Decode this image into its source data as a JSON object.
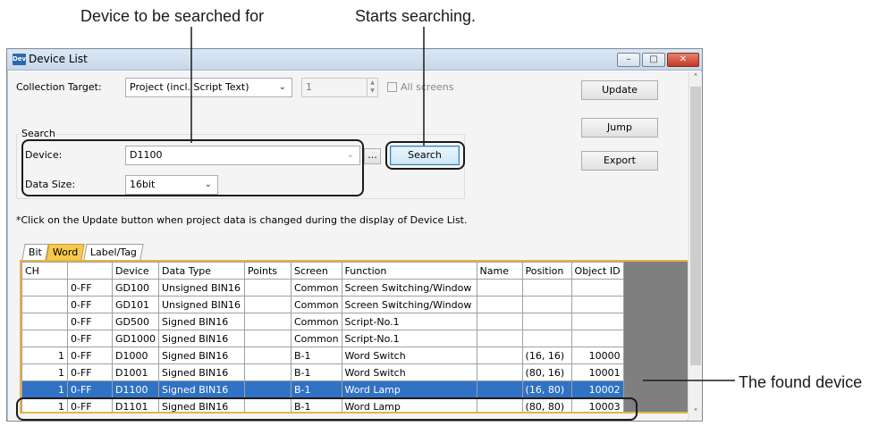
{
  "callouts": {
    "device_label": "Device to be searched for",
    "search_label": "Starts searching.",
    "found_label": "The found device"
  },
  "window": {
    "icon_text": "Dev",
    "title": "Device List",
    "min_glyph": "–",
    "max_glyph": "□",
    "close_glyph": "✕"
  },
  "form": {
    "collection_target_label": "Collection Target:",
    "collection_target_value": "Project (incl. Script Text)",
    "screen_number": "1",
    "all_screens_label": "All screens",
    "search_group_title": "Search",
    "device_label": "Device:",
    "device_value": "D1100",
    "browse_button": "...",
    "search_button": "Search",
    "data_size_label": "Data Size:",
    "data_size_value": "16bit",
    "note": "*Click on the Update button when project data is changed during the display of Device List.",
    "update_button": "Update",
    "jump_button": "Jump",
    "export_button": "Export"
  },
  "tabs": [
    {
      "label": "Bit",
      "active": false
    },
    {
      "label": "Word",
      "active": true
    },
    {
      "label": "Label/Tag",
      "active": false
    }
  ],
  "table": {
    "headers": [
      "CH",
      "",
      "Device",
      "Data Type",
      "Points",
      "Screen",
      "Function",
      "Name",
      "Position",
      "Object ID"
    ],
    "rows": [
      {
        "ch": "",
        "range": "0-FF",
        "device": "GD100",
        "type": "Unsigned BIN16",
        "points": "",
        "screen": "Common",
        "function": "Screen Switching/Window",
        "name": "",
        "position": "",
        "object_id": "",
        "selected": false
      },
      {
        "ch": "",
        "range": "0-FF",
        "device": "GD101",
        "type": "Unsigned BIN16",
        "points": "",
        "screen": "Common",
        "function": "Screen Switching/Window",
        "name": "",
        "position": "",
        "object_id": "",
        "selected": false
      },
      {
        "ch": "",
        "range": "0-FF",
        "device": "GD500",
        "type": "Signed BIN16",
        "points": "",
        "screen": "Common",
        "function": "Script-No.1",
        "name": "",
        "position": "",
        "object_id": "",
        "selected": false
      },
      {
        "ch": "",
        "range": "0-FF",
        "device": "GD1000",
        "type": "Signed BIN16",
        "points": "",
        "screen": "Common",
        "function": "Script-No.1",
        "name": "",
        "position": "",
        "object_id": "",
        "selected": false
      },
      {
        "ch": "1",
        "range": "0-FF",
        "device": "D1000",
        "type": "Signed BIN16",
        "points": "",
        "screen": "B-1",
        "function": "Word Switch",
        "name": "",
        "position": "(16, 16)",
        "object_id": "10000",
        "selected": false
      },
      {
        "ch": "1",
        "range": "0-FF",
        "device": "D1001",
        "type": "Signed BIN16",
        "points": "",
        "screen": "B-1",
        "function": "Word Switch",
        "name": "",
        "position": "(80, 16)",
        "object_id": "10001",
        "selected": false
      },
      {
        "ch": "1",
        "range": "0-FF",
        "device": "D1100",
        "type": "Signed BIN16",
        "points": "",
        "screen": "B-1",
        "function": "Word Lamp",
        "name": "",
        "position": "(16, 80)",
        "object_id": "10002",
        "selected": true
      },
      {
        "ch": "1",
        "range": "0-FF",
        "device": "D1101",
        "type": "Signed BIN16",
        "points": "",
        "screen": "B-1",
        "function": "Word Lamp",
        "name": "",
        "position": "(80, 80)",
        "object_id": "10003",
        "selected": false
      }
    ]
  },
  "colors": {
    "selection": "#3072c4",
    "active_tab": "#f7c94a",
    "grid_border": "#e8b04a"
  }
}
